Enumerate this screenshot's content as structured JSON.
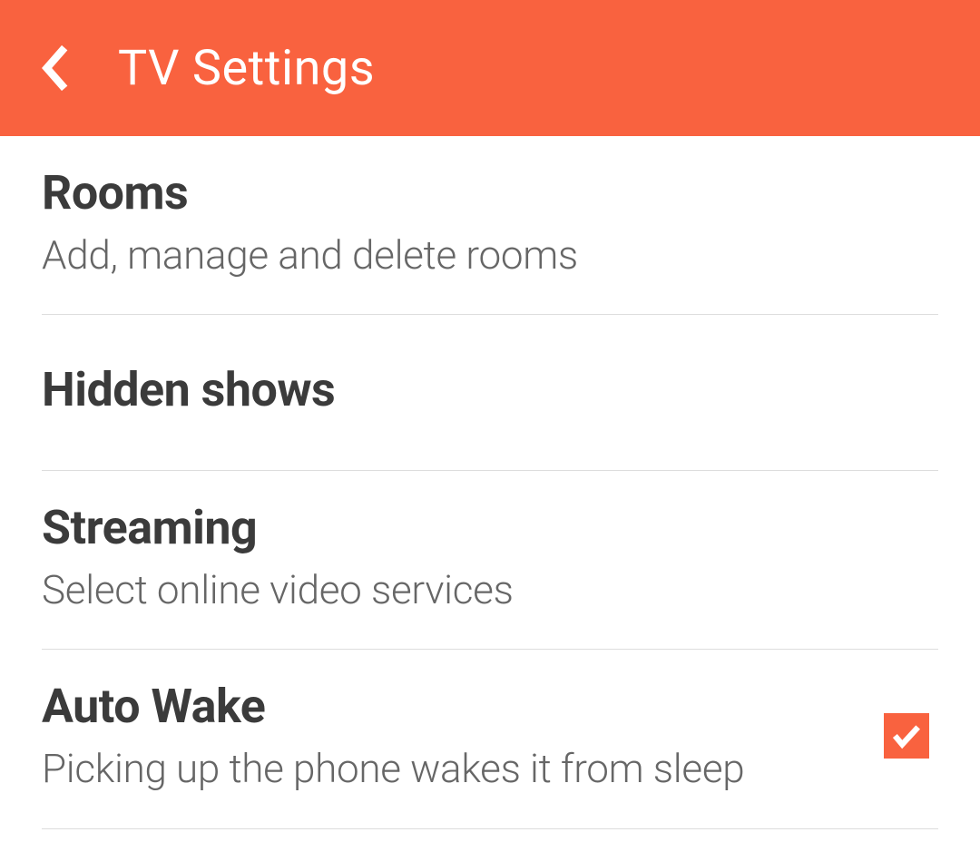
{
  "header": {
    "title": "TV Settings"
  },
  "settings": [
    {
      "title": "Rooms",
      "subtitle": "Add, manage and delete rooms",
      "has_checkbox": false,
      "checked": false
    },
    {
      "title": "Hidden shows",
      "subtitle": "",
      "has_checkbox": false,
      "checked": false
    },
    {
      "title": "Streaming",
      "subtitle": "Select online video services",
      "has_checkbox": false,
      "checked": false
    },
    {
      "title": "Auto Wake",
      "subtitle": "Picking up the phone wakes it from sleep",
      "has_checkbox": true,
      "checked": true
    }
  ],
  "colors": {
    "accent": "#f9623f"
  }
}
